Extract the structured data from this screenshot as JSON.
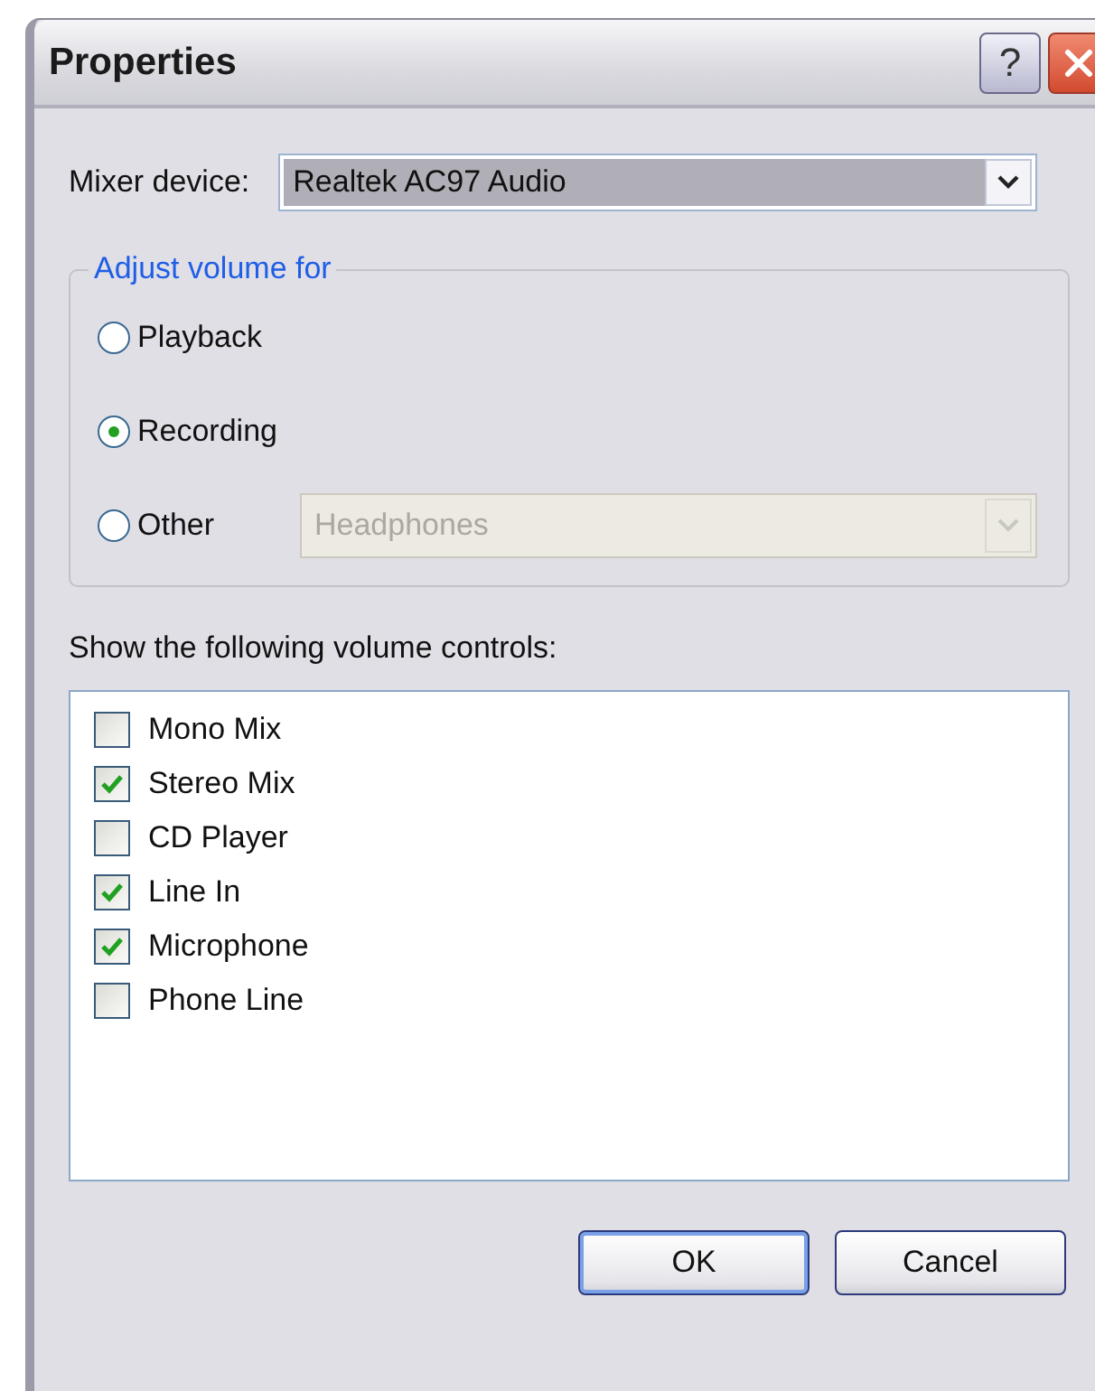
{
  "window": {
    "title": "Properties",
    "help_button": "?"
  },
  "mixer_device": {
    "label": "Mixer device:",
    "value": "Realtek AC97 Audio"
  },
  "adjust_volume_for": {
    "title": "Adjust volume for",
    "options": [
      {
        "label": "Playback",
        "selected": false
      },
      {
        "label": "Recording",
        "selected": true
      },
      {
        "label": "Other",
        "selected": false
      }
    ],
    "other_device": {
      "value": "Headphones",
      "disabled": true
    }
  },
  "volume_controls": {
    "label": "Show the following volume controls:",
    "items": [
      {
        "label": "Mono Mix",
        "checked": false
      },
      {
        "label": "Stereo Mix",
        "checked": true
      },
      {
        "label": "CD Player",
        "checked": false
      },
      {
        "label": "Line In",
        "checked": true
      },
      {
        "label": "Microphone",
        "checked": true
      },
      {
        "label": "Phone Line",
        "checked": false
      }
    ]
  },
  "buttons": [
    {
      "label": "OK",
      "default": true
    },
    {
      "label": "Cancel",
      "default": false
    }
  ]
}
